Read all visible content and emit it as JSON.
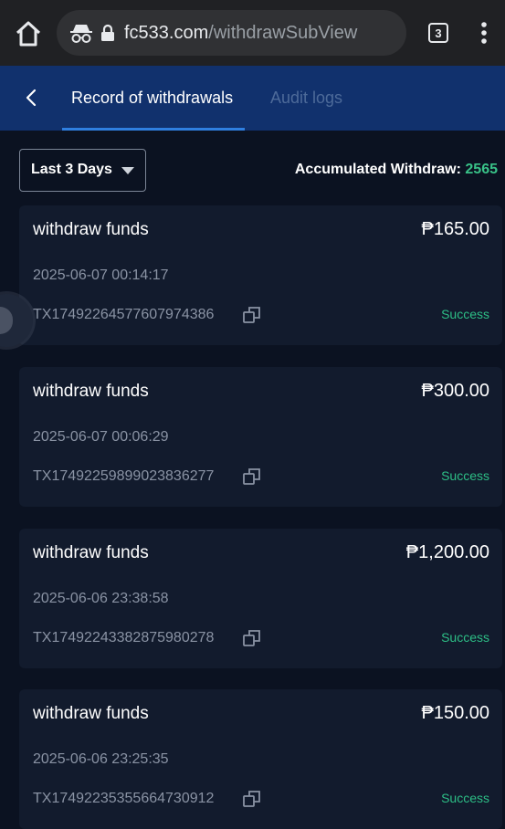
{
  "browser": {
    "url_domain": "fc533.com",
    "url_path": "/withdrawSubView",
    "tab_count": "3"
  },
  "header": {
    "tabs": [
      {
        "label": "Record of withdrawals",
        "active": true
      },
      {
        "label": "Audit logs",
        "active": false
      }
    ]
  },
  "filter": {
    "selected": "Last 3 Days",
    "accumulated_label": "Accumulated Withdraw: ",
    "accumulated_value": "2565"
  },
  "records": [
    {
      "title": "withdraw funds",
      "amount": "₱165.00",
      "time": "2025-06-07 00:14:17",
      "tx": "TX17492264577607974386",
      "status": "Success"
    },
    {
      "title": "withdraw funds",
      "amount": "₱300.00",
      "time": "2025-06-07 00:06:29",
      "tx": "TX17492259899023836277",
      "status": "Success"
    },
    {
      "title": "withdraw funds",
      "amount": "₱1,200.00",
      "time": "2025-06-06 23:38:58",
      "tx": "TX17492243382875980278",
      "status": "Success"
    },
    {
      "title": "withdraw funds",
      "amount": "₱150.00",
      "time": "2025-06-06 23:25:35",
      "tx": "TX17492235355664730912",
      "status": "Success"
    }
  ],
  "colors": {
    "accent": "#2f7fe0",
    "header_bg": "#11316d",
    "page_bg": "#0b1221",
    "card_bg": "#121b2d",
    "success": "#2dbf86",
    "accumulated_value": "#39c288"
  },
  "icons": {
    "home": "home-icon",
    "incognito": "incognito-icon",
    "lock": "lock-icon",
    "menu": "more-vert-icon",
    "back": "chevron-left-icon",
    "caret": "caret-down-icon",
    "copy": "copy-icon"
  }
}
